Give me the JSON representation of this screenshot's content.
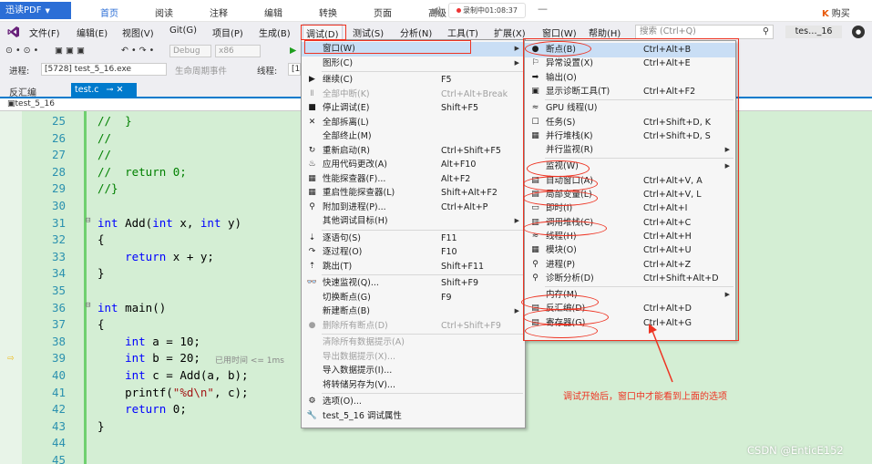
{
  "pdf_app": {
    "logo": "迅读PDF",
    "tabs": [
      "首页",
      "阅读",
      "注释",
      "编辑",
      "转换",
      "页面",
      "高级"
    ],
    "recording": "录制中01:08:37",
    "buy": "购买"
  },
  "menubar": {
    "items": [
      "文件(F)",
      "编辑(E)",
      "视图(V)",
      "Git(G)",
      "项目(P)",
      "生成(B)",
      "调试(D)",
      "测试(S)",
      "分析(N)",
      "工具(T)",
      "扩展(X)",
      "窗口(W)",
      "帮助(H)"
    ],
    "search_placeholder": "搜索 (Ctrl+Q)",
    "solution": "tes…_16"
  },
  "toolbar": {
    "config": "Debug",
    "platform": "x86",
    "process_label": "进程:",
    "process": "[5728] test_5_16.exe",
    "lifecycle": "生命周期事件",
    "thread_label": "线程:",
    "thread": "[1"
  },
  "tabs": {
    "left_panel": "反汇编",
    "doc_tab": "test.c",
    "nav_scope": "test_5_16"
  },
  "code": {
    "lines": [
      {
        "n": "25",
        "text": "//  }"
      },
      {
        "n": "26",
        "text": "//"
      },
      {
        "n": "27",
        "text": "//"
      },
      {
        "n": "28",
        "text": "//  return 0;"
      },
      {
        "n": "29",
        "text": "//}"
      },
      {
        "n": "30",
        "text": ""
      },
      {
        "n": "31",
        "text": "int Add(int x, int y)"
      },
      {
        "n": "32",
        "text": "{"
      },
      {
        "n": "33",
        "text": "    return x + y;"
      },
      {
        "n": "34",
        "text": "}"
      },
      {
        "n": "35",
        "text": ""
      },
      {
        "n": "36",
        "text": "int main()"
      },
      {
        "n": "37",
        "text": "{"
      },
      {
        "n": "38",
        "text": "    int a = 10;"
      },
      {
        "n": "39",
        "text": "    int b = 20;"
      },
      {
        "n": "40",
        "text": "    int c = Add(a, b);"
      },
      {
        "n": "41",
        "text": "    printf(\"%d\\n\", c);"
      },
      {
        "n": "42",
        "text": "    return 0;"
      },
      {
        "n": "43",
        "text": "}"
      },
      {
        "n": "44",
        "text": ""
      },
      {
        "n": "45",
        "text": ""
      }
    ],
    "elapsed_hint": "已用时间 <= 1ms"
  },
  "debug_menu": {
    "items": [
      {
        "label": "窗口(W)",
        "shortcut": "",
        "icon": "",
        "sub": true,
        "hl": true
      },
      {
        "label": "图形(C)",
        "shortcut": "",
        "icon": "",
        "sub": true
      },
      {
        "label": "继续(C)",
        "shortcut": "F5",
        "icon": "▶"
      },
      {
        "label": "全部中断(K)",
        "shortcut": "Ctrl+Alt+Break",
        "icon": "Ⅱ",
        "dis": true
      },
      {
        "label": "停止调试(E)",
        "shortcut": "Shift+F5",
        "icon": "■"
      },
      {
        "label": "全部拆离(L)",
        "shortcut": "",
        "icon": "✕"
      },
      {
        "label": "全部终止(M)",
        "shortcut": "",
        "icon": ""
      },
      {
        "label": "重新启动(R)",
        "shortcut": "Ctrl+Shift+F5",
        "icon": "↻"
      },
      {
        "label": "应用代码更改(A)",
        "shortcut": "Alt+F10",
        "icon": "♨"
      },
      {
        "label": "性能探查器(F)...",
        "shortcut": "Alt+F2",
        "icon": "▦"
      },
      {
        "label": "重启性能探查器(L)",
        "shortcut": "Shift+Alt+F2",
        "icon": "▦"
      },
      {
        "label": "附加到进程(P)...",
        "shortcut": "Ctrl+Alt+P",
        "icon": "⚲"
      },
      {
        "label": "其他调试目标(H)",
        "shortcut": "",
        "icon": "",
        "sub": true
      },
      {
        "label": "逐语句(S)",
        "shortcut": "F11",
        "icon": "⇣"
      },
      {
        "label": "逐过程(O)",
        "shortcut": "F10",
        "icon": "↷"
      },
      {
        "label": "跳出(T)",
        "shortcut": "Shift+F11",
        "icon": "⇡"
      },
      {
        "label": "快速监视(Q)...",
        "shortcut": "Shift+F9",
        "icon": "👓"
      },
      {
        "label": "切换断点(G)",
        "shortcut": "F9",
        "icon": ""
      },
      {
        "label": "新建断点(B)",
        "shortcut": "",
        "icon": "",
        "sub": true
      },
      {
        "label": "删除所有断点(D)",
        "shortcut": "Ctrl+Shift+F9",
        "icon": "●",
        "dis": true
      },
      {
        "label": "清除所有数据提示(A)",
        "shortcut": "",
        "icon": "",
        "dis": true
      },
      {
        "label": "导出数据提示(X)...",
        "shortcut": "",
        "icon": "",
        "dis": true
      },
      {
        "label": "导入数据提示(I)...",
        "shortcut": "",
        "icon": ""
      },
      {
        "label": "将转储另存为(V)...",
        "shortcut": "",
        "icon": ""
      },
      {
        "label": "选项(O)...",
        "shortcut": "",
        "icon": "⚙"
      },
      {
        "label": "test_5_16 调试属性",
        "shortcut": "",
        "icon": "🔧"
      }
    ]
  },
  "window_submenu": {
    "items": [
      {
        "label": "断点(B)",
        "shortcut": "Ctrl+Alt+B",
        "icon": "●",
        "hl": true
      },
      {
        "label": "异常设置(X)",
        "shortcut": "Ctrl+Alt+E",
        "icon": "⚐"
      },
      {
        "label": "输出(O)",
        "shortcut": "",
        "icon": "➡"
      },
      {
        "label": "显示诊断工具(T)",
        "shortcut": "Ctrl+Alt+F2",
        "icon": "▣"
      },
      {
        "label": "GPU 线程(U)",
        "shortcut": "",
        "icon": "≈"
      },
      {
        "label": "任务(S)",
        "shortcut": "Ctrl+Shift+D, K",
        "icon": "☐"
      },
      {
        "label": "并行堆栈(K)",
        "shortcut": "Ctrl+Shift+D, S",
        "icon": "▦"
      },
      {
        "label": "并行监视(R)",
        "shortcut": "",
        "icon": "",
        "sub": true
      },
      {
        "label": "监视(W)",
        "shortcut": "",
        "icon": "",
        "sub": true
      },
      {
        "label": "自动窗口(A)",
        "shortcut": "Ctrl+Alt+V, A",
        "icon": "▤"
      },
      {
        "label": "局部变量(L)",
        "shortcut": "Ctrl+Alt+V, L",
        "icon": "▤"
      },
      {
        "label": "即时(I)",
        "shortcut": "Ctrl+Alt+I",
        "icon": "▭"
      },
      {
        "label": "调用堆栈(C)",
        "shortcut": "Ctrl+Alt+C",
        "icon": "▥"
      },
      {
        "label": "线程(H)",
        "shortcut": "Ctrl+Alt+H",
        "icon": "≈"
      },
      {
        "label": "模块(O)",
        "shortcut": "Ctrl+Alt+U",
        "icon": "▦"
      },
      {
        "label": "进程(P)",
        "shortcut": "Ctrl+Alt+Z",
        "icon": "⚲"
      },
      {
        "label": "诊断分析(D)",
        "shortcut": "Ctrl+Shift+Alt+D",
        "icon": "⚲"
      },
      {
        "label": "内存(M)",
        "shortcut": "",
        "icon": "",
        "sub": true
      },
      {
        "label": "反汇编(D)",
        "shortcut": "Ctrl+Alt+D",
        "icon": "▤"
      },
      {
        "label": "寄存器(G)",
        "shortcut": "Ctrl+Alt+G",
        "icon": "▤"
      }
    ]
  },
  "annotation": {
    "note": "调试开始后，窗口中才能看到上面的选项",
    "color": "#ee3322"
  },
  "watermark": "CSDN @EnticE152"
}
